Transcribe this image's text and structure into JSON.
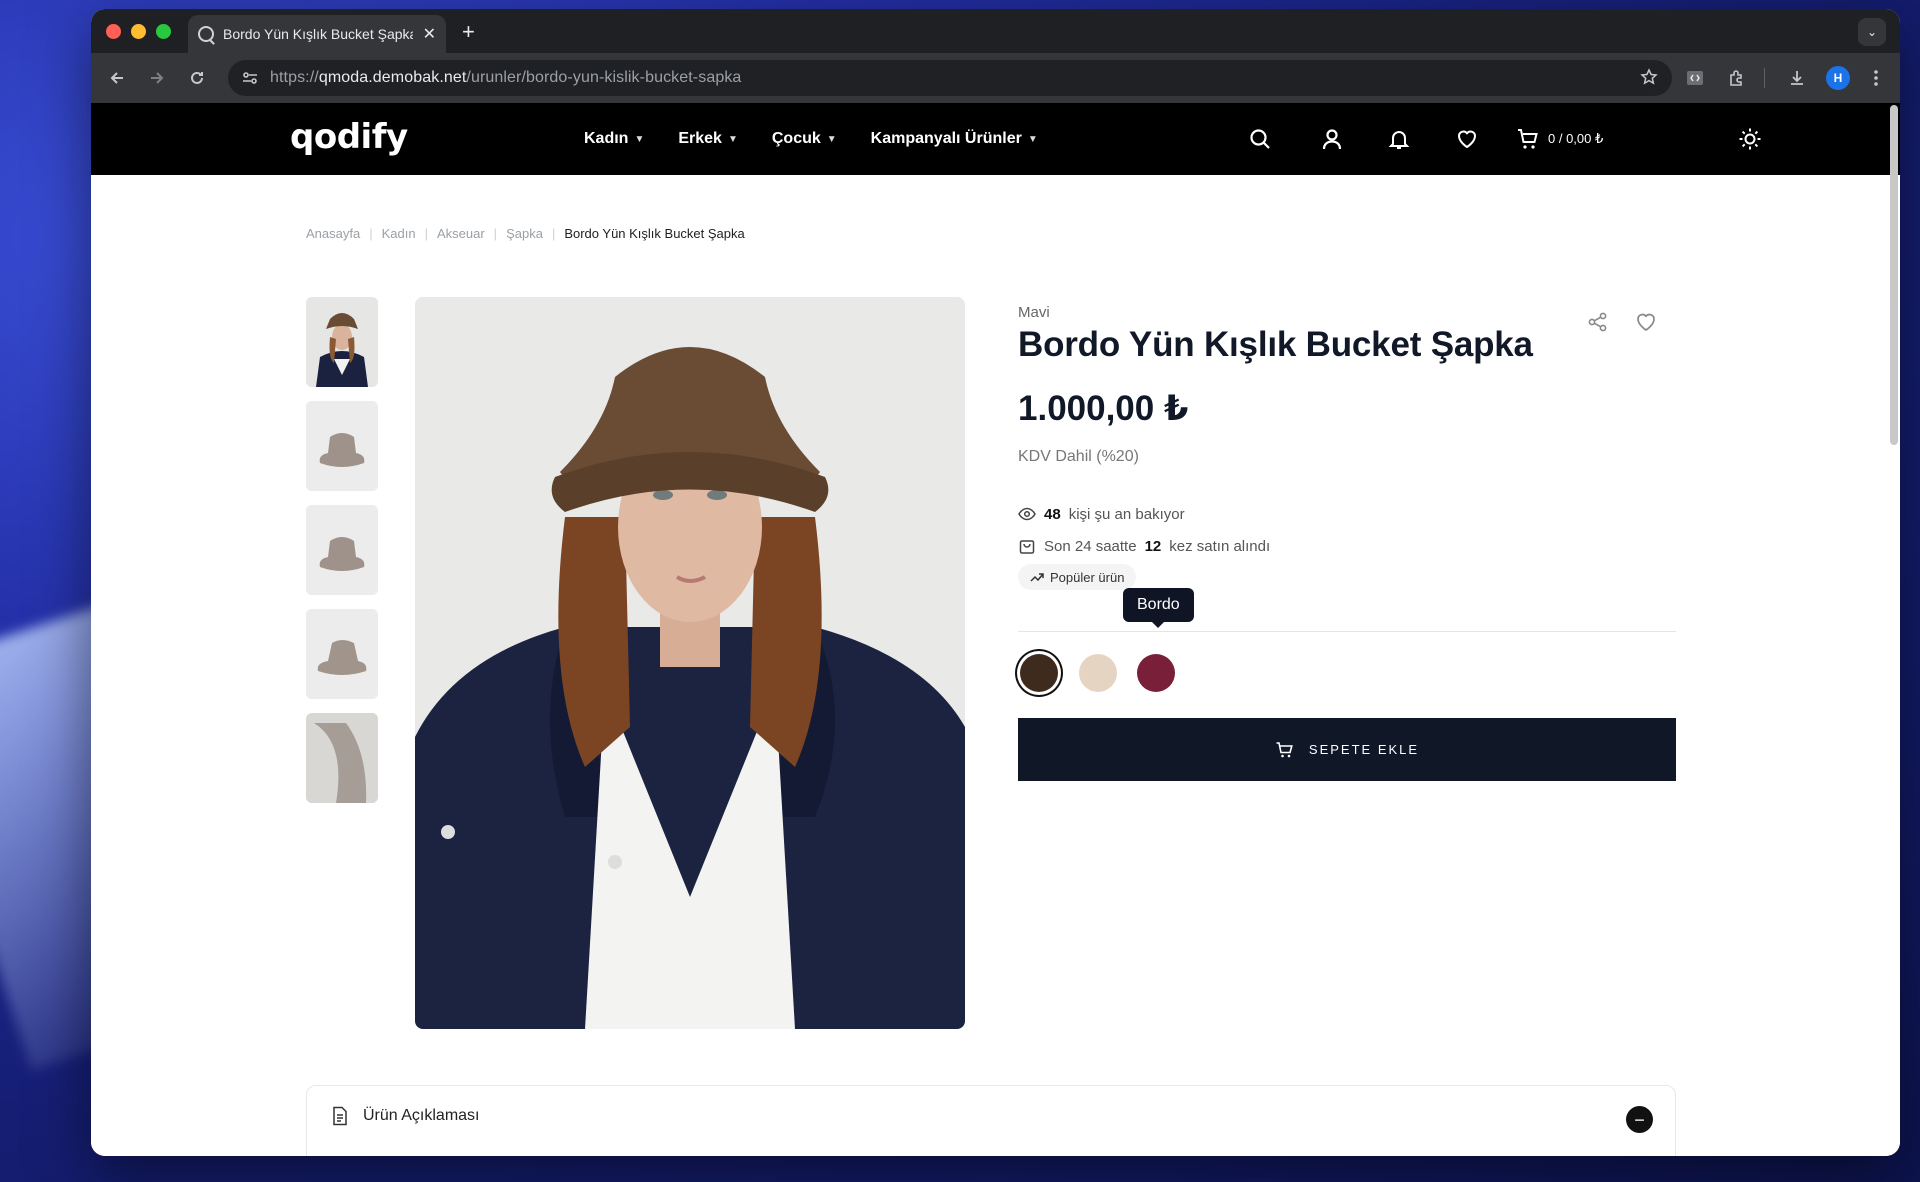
{
  "browser": {
    "tab_title": "Bordo Yün Kışlık Bucket Şapka",
    "url_prefix": "https://",
    "url_host": "qmoda.demobak.net",
    "url_path": "/urunler/bordo-yun-kislik-bucket-sapka",
    "profile_initial": "H"
  },
  "header": {
    "logo": "qodify",
    "nav": [
      "Kadın",
      "Erkek",
      "Çocuk",
      "Kampanyalı Ürünler"
    ],
    "cart_summary": "0 / 0,00 ₺"
  },
  "breadcrumb": [
    "Anasayfa",
    "Kadın",
    "Akseuar",
    "Şapka",
    "Bordo Yün Kışlık Bucket Şapka"
  ],
  "product": {
    "brand": "Mavi",
    "title": "Bordo Yün Kışlık Bucket Şapka",
    "price": "1.000,00 ₺",
    "vat_note": "KDV Dahil (%20)",
    "viewers_count": "48",
    "viewers_text": "kişi şu an bakıyor",
    "sold_prefix": "Son 24 saatte",
    "sold_count": "12",
    "sold_suffix": "kez satın alındı",
    "popular_badge": "Popüler ürün",
    "color_tooltip": "Bordo",
    "swatches": [
      {
        "color": "#3e2b1e",
        "selected": true
      },
      {
        "color": "#e6d4c2",
        "selected": false
      },
      {
        "color": "#7a1f3a",
        "selected": false
      }
    ],
    "add_to_cart": "SEPETE EKLE"
  },
  "accordion": {
    "title": "Ürün Açıklaması",
    "toggle_symbol": "−"
  },
  "colors": {
    "header_bg": "#000000",
    "button_bg": "#101828",
    "title": "#111827"
  }
}
